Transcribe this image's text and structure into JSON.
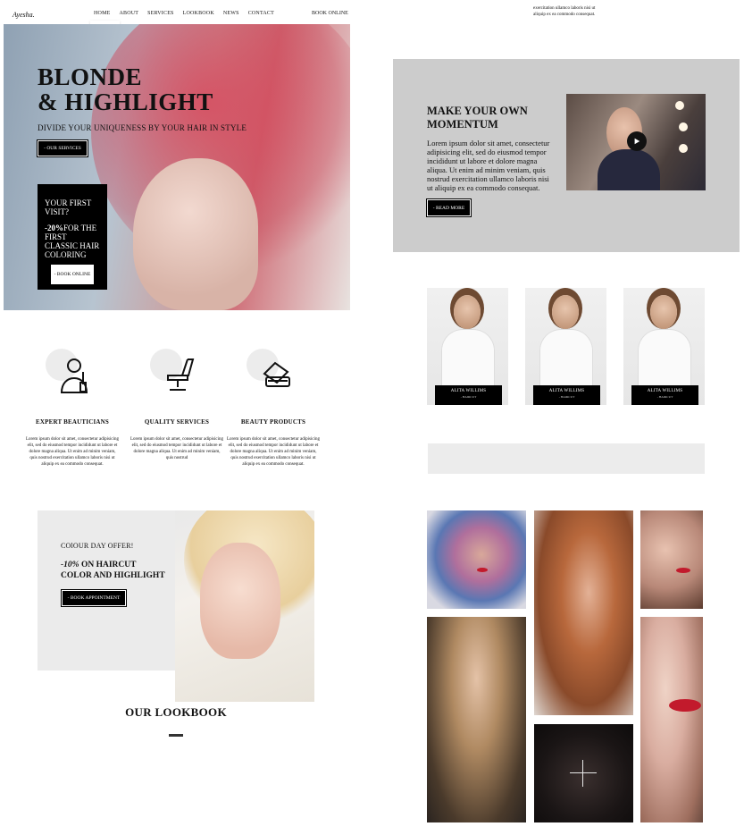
{
  "header": {
    "logo": "Ayesha.",
    "nav": [
      "HOME",
      "ABOUT",
      "SERVICES",
      "LOOKBOOK",
      "NEWS",
      "CONTACT"
    ],
    "book_online": "BOOK ONLINE",
    "dropdown_icons": [
      "search-icon",
      "cart-icon"
    ]
  },
  "hero": {
    "title_line1": "BLONDE",
    "title_line2": "& HIGHLIGHT",
    "subtitle": "DIVIDE YOUR UNIQUENESS BY YOUR HAIR IN STYLE",
    "button": "- OUR SERVICES",
    "promo": {
      "line1": "YOUR FIRST VISIT?",
      "discount": "-20%",
      "line2": "FOR THE FIRST CLASSIC HAIR COLORING",
      "button": "- BOOK ONLINE"
    }
  },
  "features": [
    {
      "icon": "beautician-icon",
      "title": "EXPERT BEAUTICIANS",
      "text": "Lorem ipsum dolor sit amet, consectetur adipisicing elit, sed do eiusmod tempor incididunt ut labore et dolore magna aliqua. Ut enim ad minim veniam, quis nostrud exercitation ullamco laboris nisi ut aliquip ex ea commodo consequat."
    },
    {
      "icon": "salon-chair-icon",
      "title": "QUALITY SERVICES",
      "text": "Lorem ipsum dolor sit amet, consectetur adipisicing elit, sed do eiusmod tempor incididunt ut labore et dolore magna aliqua. Ut enim ad minim veniam, quis nostrud"
    },
    {
      "icon": "cosmetics-icon",
      "title": "BEAUTY PRODUCTS",
      "text": "Lorem ipsum dolor sit amet, consectetur adipisicing elit, sed do eiusmod tempor incididunt ut labore et dolore magna aliqua. Ut enim ad minim veniam, quis nostrud exercitation ullamco laboris nisi ut aliquip ex ea commodo consequat."
    }
  ],
  "offer": {
    "kicker": "COlOUR DAY OFFER!",
    "discount": "-10%",
    "title_rest": " ON HAIRCUT",
    "title_line2": "COLOR AND HIGHLIGHT",
    "button": "- BOOK APPOINTMENT"
  },
  "lookbook": {
    "title": "OUR LOOKBOOK"
  },
  "right_top_fragment": {
    "line1": "exercitation ullamco laboris nisi ut",
    "line2": "aliquip ex ea commodo consequat."
  },
  "momentum": {
    "title_line1": "MAKE YOUR OWN",
    "title_line2": "MOMENTUM",
    "text": "Lorem ipsum dolor sit amet, consectetur adipisicing elit, sed do eiusmod tempor incididunt ut labore et dolore magna aliqua. Ut enim ad minim veniam, quis nostrud exercitation ullamco laboris nisi ut aliquip ex ea commodo consequat.",
    "button": "- READ MORE"
  },
  "team": [
    {
      "name": "ALITA WILLIMS",
      "role": "- HAIRCUT"
    },
    {
      "name": "ALITA WILLIMS",
      "role": "- HAIRCUT"
    },
    {
      "name": "ALITA WILLIMS",
      "role": "- HAIRCUT"
    }
  ]
}
